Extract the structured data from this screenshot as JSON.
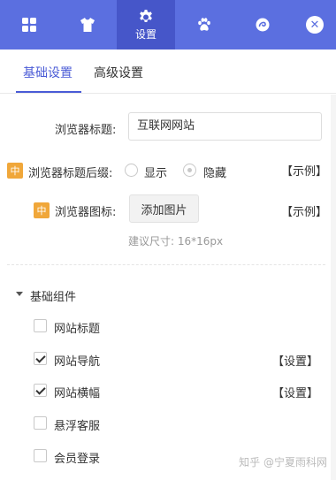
{
  "toolbar": {
    "items": [
      {
        "icon": "grid-icon",
        "label": ""
      },
      {
        "icon": "shirt-icon",
        "label": ""
      },
      {
        "icon": "gear-icon",
        "label": "设置"
      },
      {
        "icon": "paw-icon",
        "label": ""
      },
      {
        "icon": "swirl-icon",
        "label": ""
      }
    ],
    "close_icon": "close-icon",
    "accent_color": "#5b6fe0"
  },
  "tabs": {
    "basic": "基础设置",
    "advanced": "高级设置"
  },
  "form": {
    "browser_title_label": "浏览器标题:",
    "browser_title_value": "互联网网站",
    "suffix_badge": "中",
    "suffix_label": "浏览器标题后缀:",
    "suffix_show": "显示",
    "suffix_hide": "隐藏",
    "suffix_example": "【示例】",
    "icon_badge": "中",
    "icon_label": "浏览器图标:",
    "add_image_button": "添加图片",
    "icon_example": "【示例】",
    "size_hint": "建议尺寸: 16*16px"
  },
  "components": {
    "section_label": "基础组件",
    "items": [
      {
        "label": "网站标题",
        "checked": false,
        "action": ""
      },
      {
        "label": "网站导航",
        "checked": true,
        "action": "【设置】"
      },
      {
        "label": "网站横幅",
        "checked": true,
        "action": "【设置】"
      },
      {
        "label": "悬浮客服",
        "checked": false,
        "action": ""
      },
      {
        "label": "会员登录",
        "checked": false,
        "action": ""
      }
    ]
  },
  "watermark": "知乎 @宁夏雨科网"
}
